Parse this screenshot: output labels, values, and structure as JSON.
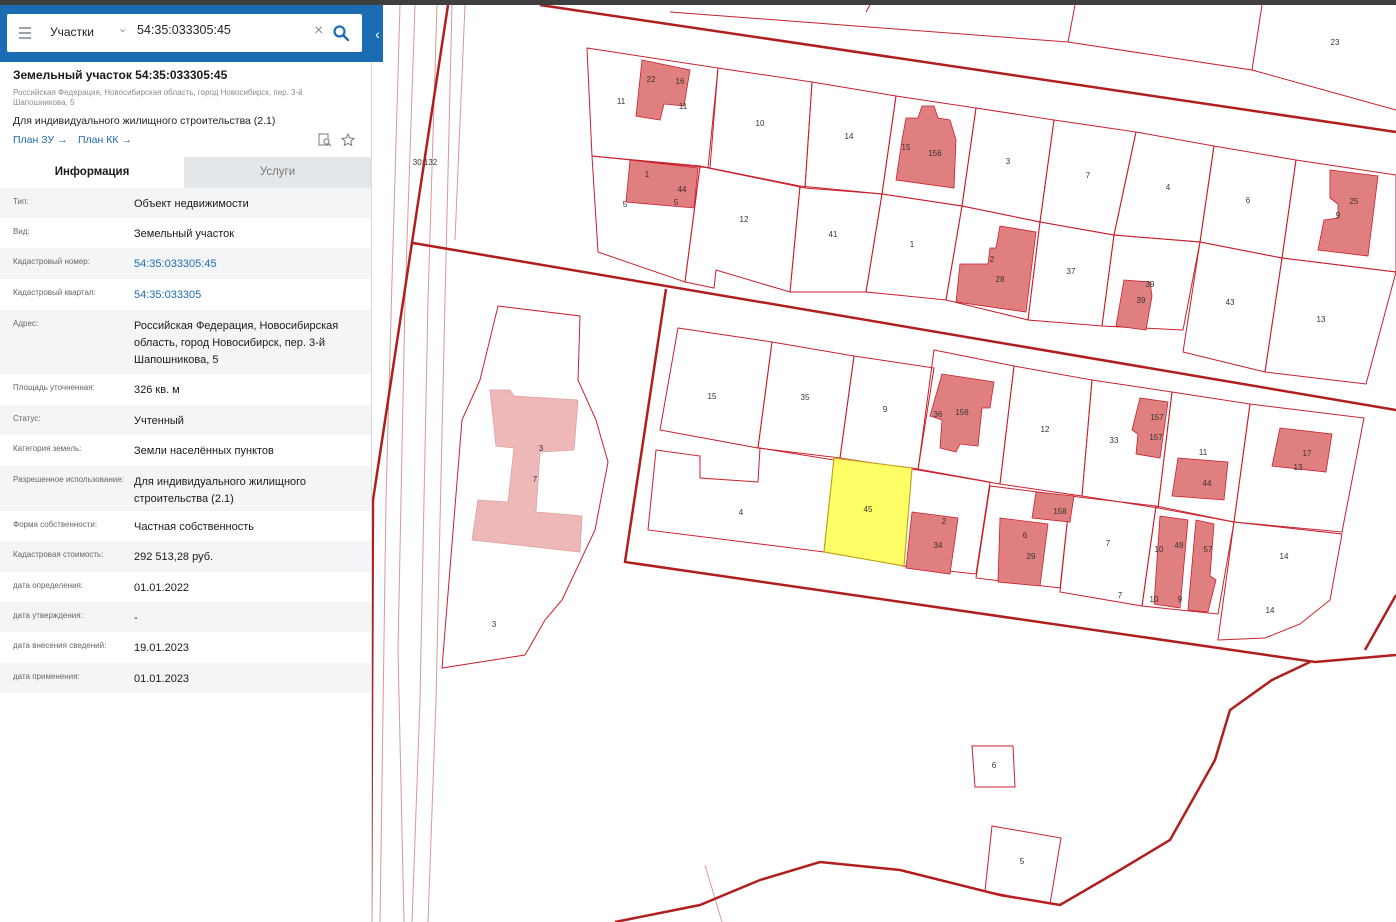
{
  "search": {
    "layer": "Участки",
    "query": "54:35:033305:45"
  },
  "parcel": {
    "title": "Земельный участок 54:35:033305:45",
    "address": "Российская Федерация, Новосибирская область, город Новосибирск, пер. 3-й Шапошникова, 5",
    "purpose": "Для индивидуального жилищного строительства (2.1)",
    "links": [
      "План ЗУ →",
      "План КК →"
    ]
  },
  "tabs": [
    "Информация",
    "Услуги"
  ],
  "rows": [
    {
      "k": "Тип:",
      "v": "Объект недвижимости"
    },
    {
      "k": "Вид:",
      "v": "Земельный участок"
    },
    {
      "k": "Кадастровый номер:",
      "v": "54:35:033305:45"
    },
    {
      "k": "Кадастровый квартал:",
      "v": "54:35:033305"
    },
    {
      "k": "Адрес:",
      "v": "Российская Федерация, Новосибирская область, город Новосибирск, пер. 3-й Шапошникова, 5"
    },
    {
      "k": "Площадь уточненная:",
      "v": "326 кв. м"
    },
    {
      "k": "Статус:",
      "v": "Учтенный"
    },
    {
      "k": "Категория земель:",
      "v": "Земли населённых пунктов"
    },
    {
      "k": "Разрешенное использование:",
      "v": "Для индивидуального жилищного строительства (2.1)"
    },
    {
      "k": "Форма собственности:",
      "v": "Частная собственность"
    },
    {
      "k": "Кадастровая стоимость:",
      "v": "292 513,28 руб."
    },
    {
      "k": "дата определения:",
      "v": "01.01.2022"
    },
    {
      "k": "дата утверждения:",
      "v": "-"
    },
    {
      "k": "дата внесения сведений:",
      "v": "19.01.2023"
    },
    {
      "k": "дата применения:",
      "v": "01.01.2023"
    }
  ],
  "map": {
    "colors": {
      "boundary": "#b01e1e",
      "parcel": "#c8202c",
      "building": "#e07f7f",
      "selected": "#ffff66",
      "pale_building": "#efb8b8"
    },
    "labels": [
      "30:132",
      "23",
      "11",
      "22",
      "16",
      "11",
      "10",
      "14",
      "15",
      "156",
      "3",
      "7",
      "4",
      "6",
      "25",
      "9",
      "1",
      "44",
      "5",
      "5",
      "12",
      "41",
      "1",
      "2",
      "28",
      "37",
      "39",
      "39",
      "43",
      "13",
      "15",
      "35",
      "9",
      "36",
      "156",
      "12",
      "33",
      "157",
      "157",
      "11",
      "44",
      "17",
      "13",
      "4",
      "45",
      "2",
      "34",
      "158",
      "6",
      "29",
      "7",
      "10",
      "49",
      "57",
      "10",
      "9",
      "14",
      "7",
      "14",
      "3",
      "7",
      "3",
      "6",
      "5"
    ]
  }
}
